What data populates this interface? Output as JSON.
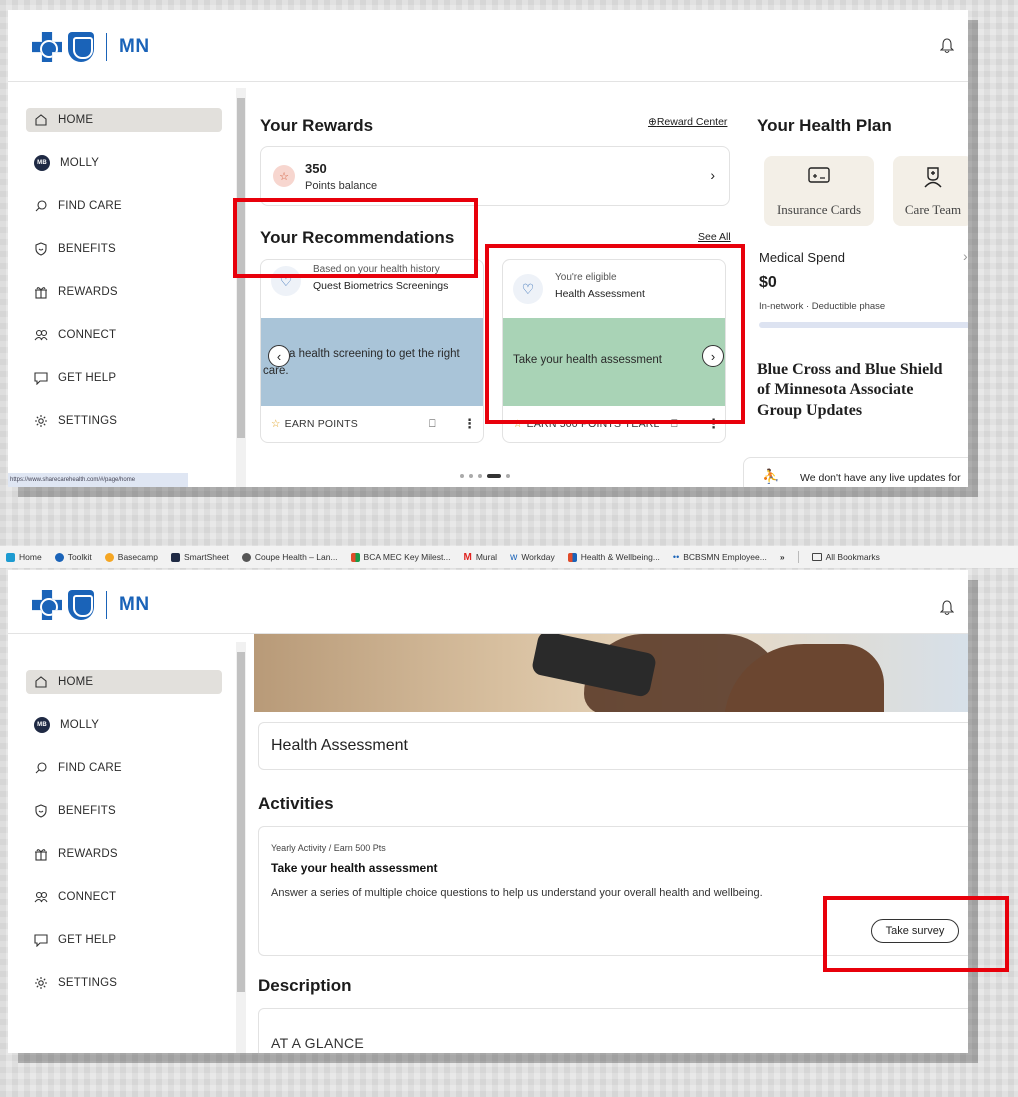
{
  "brand": {
    "state": "MN"
  },
  "nav": [
    {
      "label": "HOME",
      "icon": "home-icon"
    },
    {
      "label": "MOLLY",
      "icon": "avatar",
      "initials": "MB"
    },
    {
      "label": "FIND CARE",
      "icon": "search-icon"
    },
    {
      "label": "BENEFITS",
      "icon": "shield-icon"
    },
    {
      "label": "REWARDS",
      "icon": "gift-icon"
    },
    {
      "label": "CONNECT",
      "icon": "people-icon"
    },
    {
      "label": "GET HELP",
      "icon": "chat-icon"
    },
    {
      "label": "SETTINGS",
      "icon": "gear-icon"
    }
  ],
  "status_url": "https://www.sharecarehealth.com/#/page/home",
  "rewards": {
    "heading": "Your Rewards",
    "center_link": "Reward Center",
    "points": "350",
    "points_label": "Points balance"
  },
  "recommendations": {
    "heading": "Your Recommendations",
    "see_all": "See All",
    "cards": [
      {
        "line1": "Based on your health history",
        "line2": "Quest Biometrics Screenings",
        "body": "a health screening to get the right care.",
        "body_line1": "a health screening to get the right",
        "body_line2": "care.",
        "band_color": "#a9c4d8",
        "earn": "EARN POINTS"
      },
      {
        "line1": "You're eligible",
        "line2": "Health Assessment",
        "body": "Take your health assessment",
        "band_color": "#a9d3b6",
        "earn": "EARN 500 POINTS YEARL"
      }
    ]
  },
  "health_plan": {
    "heading": "Your Health Plan",
    "tiles": [
      "Insurance Cards",
      "Care Team"
    ],
    "medical_spend_label": "Medical Spend",
    "medical_spend_value": "$0",
    "medical_spend_note": "In-network · Deductible phase",
    "updates_heading": "Blue Cross and Blue Shield of Minnesota Associate Group Updates",
    "updates_text": "We don't have any live updates for"
  },
  "bookmarks": [
    {
      "label": "Home",
      "color": "#1d9bd1"
    },
    {
      "label": "Toolkit",
      "color": "#1a63b8"
    },
    {
      "label": "Basecamp",
      "color": "#f5a623"
    },
    {
      "label": "SmartSheet",
      "color": "#1f2a44"
    },
    {
      "label": "Coupe Health – Lan...",
      "color": "#555555"
    },
    {
      "label": "BCA MEC Key Milest...",
      "color": "#e04b2a"
    },
    {
      "label": "Mural",
      "color": "#e0231f"
    },
    {
      "label": "Workday",
      "color": "#1a63b8"
    },
    {
      "label": "Health & Wellbeing...",
      "color": "#e04b2a"
    },
    {
      "label": "BCBSMN Employee...",
      "color": "#1a63b8"
    }
  ],
  "bookmarks_overflow": "»",
  "bookmarks_all": "All Bookmarks",
  "assessment": {
    "title": "Health Assessment",
    "activities_heading": "Activities",
    "activity_meta": "Yearly Activity / Earn 500 Pts",
    "activity_title": "Take your health assessment",
    "activity_desc": "Answer a series of multiple choice questions to help us understand your overall health and wellbeing.",
    "survey_button": "Take survey",
    "description_heading": "Description",
    "glance": "AT A GLANCE"
  }
}
